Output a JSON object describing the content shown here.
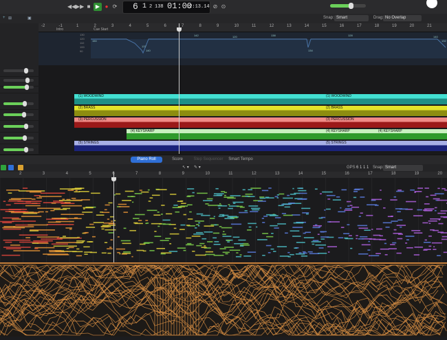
{
  "transport": {
    "rewind_icon": "rewind-icon",
    "forward_icon": "fast-forward-icon",
    "stop_icon": "stop-icon",
    "play_icon": "play-icon",
    "record_icon": "record-icon",
    "bar": "6",
    "beat": "1",
    "sub": "2",
    "tempo": "138",
    "time": "01:00",
    "smpte": "12:13.14"
  },
  "toolbar": {
    "snap_label": "Snap:",
    "snap_value": "Smart",
    "drag_label": "Drag:",
    "drag_value": "No Overlap"
  },
  "ruler": {
    "numbers": [
      "-2",
      "-1",
      "1",
      "2",
      "3",
      "4",
      "5",
      "6",
      "7",
      "8",
      "9",
      "10",
      "11",
      "12",
      "13",
      "14",
      "15",
      "16",
      "17",
      "18",
      "19",
      "20",
      "21"
    ],
    "markers": [
      "Intro",
      "Cue Start"
    ]
  },
  "tempo_track": {
    "values": [
      "150",
      "142",
      "137",
      "140",
      "120",
      "138",
      "134",
      "128",
      "140",
      "132"
    ],
    "axis": [
      "130",
      "120",
      "110",
      "100",
      "90"
    ]
  },
  "regions": [
    {
      "label": "(1) WOODWIND",
      "label2": "(1) WOODWIND",
      "color": "#43e0d2",
      "accent": "#1f8f86"
    },
    {
      "label": "(2) BRASS",
      "label2": "(2) BRASS",
      "color": "#e2e32a",
      "accent": "#8d8d10"
    },
    {
      "label": "(3) PERCUSSION",
      "label2": "(3) PERCUSSION",
      "color": "#f08a86",
      "accent": "#9b1919"
    },
    {
      "label": "(4) KEYSHARP",
      "label2": "(4) KEYSHARP",
      "label3": "(4) KEYSHARP",
      "color": "#2f9a2c",
      "accent": "#1a6e17"
    },
    {
      "label": "(5) STRINGS",
      "label2": "(5) STRINGS",
      "color": "#a8b0e6",
      "accent": "#1b237a"
    }
  ],
  "editor": {
    "tabs": [
      "Piano Roll",
      "Score",
      "Step Sequencer",
      "Smart Tempo"
    ],
    "gps_label": "GPS",
    "gps_value": "6 1 1 1",
    "snap_label": "Snap:",
    "snap_value": "Smart",
    "ruler": [
      "2",
      "3",
      "4",
      "5",
      "6",
      "7",
      "8",
      "9",
      "10",
      "11",
      "12",
      "13",
      "14",
      "15",
      "16",
      "17",
      "18",
      "19",
      "20"
    ]
  },
  "colors": {
    "accent_green": "#6bd05a",
    "automation": "#d88f44",
    "tab_active": "#2f6fd6"
  }
}
